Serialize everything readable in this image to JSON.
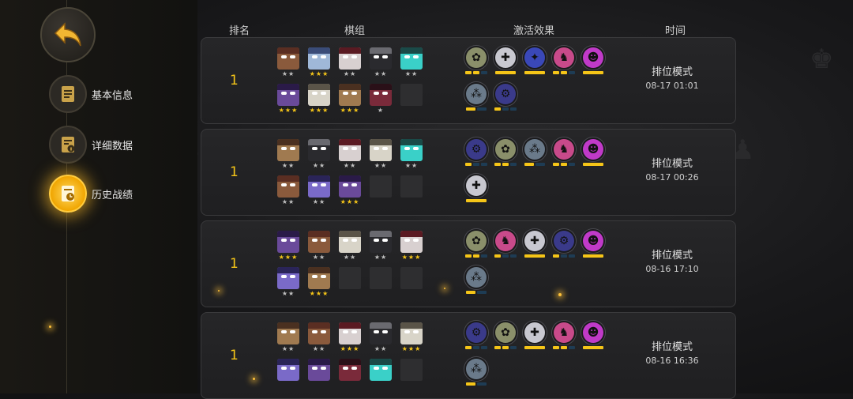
{
  "sidebar": {
    "back": "back",
    "items": [
      {
        "label": "基本信息",
        "icon": "document-icon",
        "active": false
      },
      {
        "label": "详细数据",
        "icon": "data-sheet-icon",
        "active": false
      },
      {
        "label": "历史战绩",
        "icon": "history-icon",
        "active": true
      }
    ]
  },
  "header": {
    "rank": "排名",
    "lineup": "棋组",
    "synergy": "激活效果",
    "time": "时间"
  },
  "colors": {
    "accent": "#f5c518",
    "card_bg": "#242426",
    "bar_off": "#1e3c54"
  },
  "records": [
    {
      "rank": "1",
      "mode": "排位模式",
      "time": "08-17 01:01",
      "units": [
        {
          "type": "chief",
          "stars": 2
        },
        {
          "type": "robot",
          "stars": 3
        },
        {
          "type": "vampire",
          "stars": 2
        },
        {
          "type": "ninja",
          "stars": 2
        },
        {
          "type": "cyber",
          "stars": 2
        },
        {
          "type": "bat",
          "stars": 3
        },
        {
          "type": "monk",
          "stars": 3
        },
        {
          "type": "sentinel",
          "stars": 3
        },
        {
          "type": "demon",
          "stars": 1
        },
        {
          "type": "empty",
          "stars": 0
        }
      ],
      "synergies": [
        {
          "icon": "paw-icon",
          "bars": [
            1,
            1,
            0
          ]
        },
        {
          "icon": "cross-icon",
          "bars": [
            1
          ]
        },
        {
          "icon": "wings-icon",
          "bars": [
            1
          ]
        },
        {
          "icon": "knight-icon",
          "bars": [
            1,
            1,
            0
          ]
        },
        {
          "icon": "demon-icon",
          "bars": [
            1
          ]
        },
        {
          "icon": "claw-icon",
          "bars": [
            1,
            0
          ]
        },
        {
          "icon": "machine-icon",
          "bars": [
            1,
            0,
            0
          ]
        }
      ]
    },
    {
      "rank": "1",
      "mode": "排位模式",
      "time": "08-17 00:26",
      "units": [
        {
          "type": "sentinel",
          "stars": 2
        },
        {
          "type": "ninja",
          "stars": 2
        },
        {
          "type": "vampire",
          "stars": 2
        },
        {
          "type": "monk",
          "stars": 2
        },
        {
          "type": "cyber",
          "stars": 2
        },
        {
          "type": "chief",
          "stars": 2
        },
        {
          "type": "golem",
          "stars": 2
        },
        {
          "type": "bat",
          "stars": 3
        },
        {
          "type": "empty",
          "stars": 0
        },
        {
          "type": "empty",
          "stars": 0
        }
      ],
      "synergies": [
        {
          "icon": "machine-icon",
          "bars": [
            1,
            0,
            0
          ]
        },
        {
          "icon": "paw-icon",
          "bars": [
            1,
            1,
            0
          ]
        },
        {
          "icon": "claw-icon",
          "bars": [
            1,
            0
          ]
        },
        {
          "icon": "knight-icon",
          "bars": [
            1,
            1,
            0
          ]
        },
        {
          "icon": "demon-icon",
          "bars": [
            1
          ]
        },
        {
          "icon": "cross-icon",
          "bars": [
            1
          ]
        }
      ]
    },
    {
      "rank": "1",
      "mode": "排位模式",
      "time": "08-16 17:10",
      "units": [
        {
          "type": "bat",
          "stars": 3
        },
        {
          "type": "chief",
          "stars": 2
        },
        {
          "type": "monk",
          "stars": 2
        },
        {
          "type": "ninja",
          "stars": 2
        },
        {
          "type": "vampire",
          "stars": 3
        },
        {
          "type": "golem",
          "stars": 2
        },
        {
          "type": "sentinel",
          "stars": 3
        },
        {
          "type": "empty",
          "stars": 0
        },
        {
          "type": "empty",
          "stars": 0
        },
        {
          "type": "empty",
          "stars": 0
        }
      ],
      "synergies": [
        {
          "icon": "paw-icon",
          "bars": [
            1,
            1,
            0
          ]
        },
        {
          "icon": "knight-icon",
          "bars": [
            1,
            0,
            0
          ]
        },
        {
          "icon": "cross-icon",
          "bars": [
            1
          ]
        },
        {
          "icon": "machine-icon",
          "bars": [
            1,
            0,
            0
          ]
        },
        {
          "icon": "demon-icon",
          "bars": [
            1
          ]
        },
        {
          "icon": "claw-icon",
          "bars": [
            1,
            0
          ]
        }
      ]
    },
    {
      "rank": "1",
      "mode": "排位模式",
      "time": "08-16 16:36",
      "units": [
        {
          "type": "sentinel",
          "stars": 2
        },
        {
          "type": "chief",
          "stars": 2
        },
        {
          "type": "vampire",
          "stars": 3
        },
        {
          "type": "ninja",
          "stars": 2
        },
        {
          "type": "monk",
          "stars": 3
        },
        {
          "type": "golem",
          "stars": 0
        },
        {
          "type": "bat",
          "stars": 0
        },
        {
          "type": "demon",
          "stars": 0
        },
        {
          "type": "cyber",
          "stars": 0
        },
        {
          "type": "empty",
          "stars": 0
        }
      ],
      "synergies": [
        {
          "icon": "machine-icon",
          "bars": [
            1,
            0,
            0
          ]
        },
        {
          "icon": "paw-icon",
          "bars": [
            1,
            1,
            0
          ]
        },
        {
          "icon": "cross-icon",
          "bars": [
            1
          ]
        },
        {
          "icon": "knight-icon",
          "bars": [
            1,
            1,
            0
          ]
        },
        {
          "icon": "demon-icon",
          "bars": [
            1
          ]
        },
        {
          "icon": "claw-icon",
          "bars": [
            1,
            0
          ]
        }
      ]
    }
  ]
}
